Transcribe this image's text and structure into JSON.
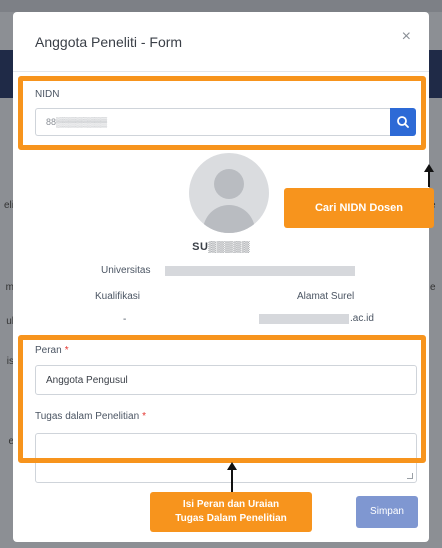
{
  "modal": {
    "title": "Anggota Peneliti - Form",
    "close_glyph": "×"
  },
  "nidn": {
    "label": "NIDN",
    "value": "88▒▒▒▒▒▒▒▒",
    "search_icon": "search-icon"
  },
  "researcher": {
    "name": "SU▒▒▒▒▒",
    "university_label": "Universitas",
    "qualification_label": "Kualifikasi",
    "qualification_value": "-",
    "email_label": "Alamat Surel",
    "email_suffix": ".ac.id"
  },
  "role": {
    "label": "Peran",
    "required_mark": "*",
    "value": "Anggota Pengusul"
  },
  "duty": {
    "label": "Tugas dalam Penelitian",
    "required_mark": "*",
    "value": ""
  },
  "save_label": "Simpan",
  "annotations": {
    "search_callout": "Cari NIDN Dosen",
    "role_callout_line1": "Isi Peran dan Uraian",
    "role_callout_line2": "Tugas Dalam Penelitian",
    "accent_color": "#f7941d"
  },
  "backdrop": {
    "left_fragments": [
      "eli",
      "m",
      "ul",
      "is",
      "e"
    ],
    "right_fragments": [
      "e",
      "e"
    ]
  }
}
